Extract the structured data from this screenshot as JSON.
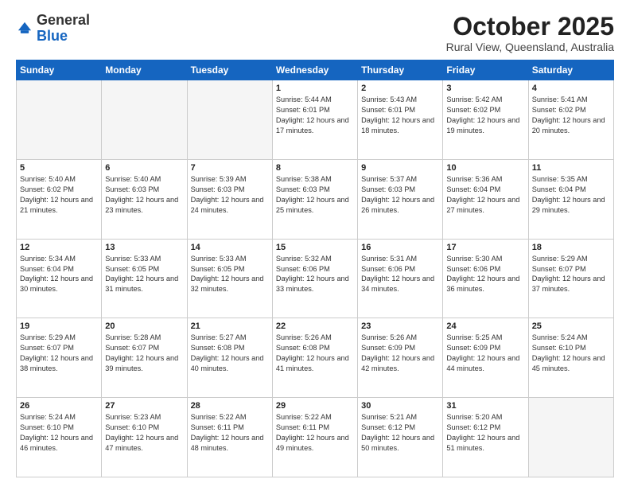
{
  "header": {
    "logo_general": "General",
    "logo_blue": "Blue",
    "month_title": "October 2025",
    "subtitle": "Rural View, Queensland, Australia"
  },
  "weekdays": [
    "Sunday",
    "Monday",
    "Tuesday",
    "Wednesday",
    "Thursday",
    "Friday",
    "Saturday"
  ],
  "weeks": [
    [
      {
        "day": "",
        "sunrise": "",
        "sunset": "",
        "daylight": "",
        "empty": true
      },
      {
        "day": "",
        "sunrise": "",
        "sunset": "",
        "daylight": "",
        "empty": true
      },
      {
        "day": "",
        "sunrise": "",
        "sunset": "",
        "daylight": "",
        "empty": true
      },
      {
        "day": "1",
        "sunrise": "Sunrise: 5:44 AM",
        "sunset": "Sunset: 6:01 PM",
        "daylight": "Daylight: 12 hours and 17 minutes.",
        "empty": false
      },
      {
        "day": "2",
        "sunrise": "Sunrise: 5:43 AM",
        "sunset": "Sunset: 6:01 PM",
        "daylight": "Daylight: 12 hours and 18 minutes.",
        "empty": false
      },
      {
        "day": "3",
        "sunrise": "Sunrise: 5:42 AM",
        "sunset": "Sunset: 6:02 PM",
        "daylight": "Daylight: 12 hours and 19 minutes.",
        "empty": false
      },
      {
        "day": "4",
        "sunrise": "Sunrise: 5:41 AM",
        "sunset": "Sunset: 6:02 PM",
        "daylight": "Daylight: 12 hours and 20 minutes.",
        "empty": false
      }
    ],
    [
      {
        "day": "5",
        "sunrise": "Sunrise: 5:40 AM",
        "sunset": "Sunset: 6:02 PM",
        "daylight": "Daylight: 12 hours and 21 minutes.",
        "empty": false
      },
      {
        "day": "6",
        "sunrise": "Sunrise: 5:40 AM",
        "sunset": "Sunset: 6:03 PM",
        "daylight": "Daylight: 12 hours and 23 minutes.",
        "empty": false
      },
      {
        "day": "7",
        "sunrise": "Sunrise: 5:39 AM",
        "sunset": "Sunset: 6:03 PM",
        "daylight": "Daylight: 12 hours and 24 minutes.",
        "empty": false
      },
      {
        "day": "8",
        "sunrise": "Sunrise: 5:38 AM",
        "sunset": "Sunset: 6:03 PM",
        "daylight": "Daylight: 12 hours and 25 minutes.",
        "empty": false
      },
      {
        "day": "9",
        "sunrise": "Sunrise: 5:37 AM",
        "sunset": "Sunset: 6:03 PM",
        "daylight": "Daylight: 12 hours and 26 minutes.",
        "empty": false
      },
      {
        "day": "10",
        "sunrise": "Sunrise: 5:36 AM",
        "sunset": "Sunset: 6:04 PM",
        "daylight": "Daylight: 12 hours and 27 minutes.",
        "empty": false
      },
      {
        "day": "11",
        "sunrise": "Sunrise: 5:35 AM",
        "sunset": "Sunset: 6:04 PM",
        "daylight": "Daylight: 12 hours and 29 minutes.",
        "empty": false
      }
    ],
    [
      {
        "day": "12",
        "sunrise": "Sunrise: 5:34 AM",
        "sunset": "Sunset: 6:04 PM",
        "daylight": "Daylight: 12 hours and 30 minutes.",
        "empty": false
      },
      {
        "day": "13",
        "sunrise": "Sunrise: 5:33 AM",
        "sunset": "Sunset: 6:05 PM",
        "daylight": "Daylight: 12 hours and 31 minutes.",
        "empty": false
      },
      {
        "day": "14",
        "sunrise": "Sunrise: 5:33 AM",
        "sunset": "Sunset: 6:05 PM",
        "daylight": "Daylight: 12 hours and 32 minutes.",
        "empty": false
      },
      {
        "day": "15",
        "sunrise": "Sunrise: 5:32 AM",
        "sunset": "Sunset: 6:06 PM",
        "daylight": "Daylight: 12 hours and 33 minutes.",
        "empty": false
      },
      {
        "day": "16",
        "sunrise": "Sunrise: 5:31 AM",
        "sunset": "Sunset: 6:06 PM",
        "daylight": "Daylight: 12 hours and 34 minutes.",
        "empty": false
      },
      {
        "day": "17",
        "sunrise": "Sunrise: 5:30 AM",
        "sunset": "Sunset: 6:06 PM",
        "daylight": "Daylight: 12 hours and 36 minutes.",
        "empty": false
      },
      {
        "day": "18",
        "sunrise": "Sunrise: 5:29 AM",
        "sunset": "Sunset: 6:07 PM",
        "daylight": "Daylight: 12 hours and 37 minutes.",
        "empty": false
      }
    ],
    [
      {
        "day": "19",
        "sunrise": "Sunrise: 5:29 AM",
        "sunset": "Sunset: 6:07 PM",
        "daylight": "Daylight: 12 hours and 38 minutes.",
        "empty": false
      },
      {
        "day": "20",
        "sunrise": "Sunrise: 5:28 AM",
        "sunset": "Sunset: 6:07 PM",
        "daylight": "Daylight: 12 hours and 39 minutes.",
        "empty": false
      },
      {
        "day": "21",
        "sunrise": "Sunrise: 5:27 AM",
        "sunset": "Sunset: 6:08 PM",
        "daylight": "Daylight: 12 hours and 40 minutes.",
        "empty": false
      },
      {
        "day": "22",
        "sunrise": "Sunrise: 5:26 AM",
        "sunset": "Sunset: 6:08 PM",
        "daylight": "Daylight: 12 hours and 41 minutes.",
        "empty": false
      },
      {
        "day": "23",
        "sunrise": "Sunrise: 5:26 AM",
        "sunset": "Sunset: 6:09 PM",
        "daylight": "Daylight: 12 hours and 42 minutes.",
        "empty": false
      },
      {
        "day": "24",
        "sunrise": "Sunrise: 5:25 AM",
        "sunset": "Sunset: 6:09 PM",
        "daylight": "Daylight: 12 hours and 44 minutes.",
        "empty": false
      },
      {
        "day": "25",
        "sunrise": "Sunrise: 5:24 AM",
        "sunset": "Sunset: 6:10 PM",
        "daylight": "Daylight: 12 hours and 45 minutes.",
        "empty": false
      }
    ],
    [
      {
        "day": "26",
        "sunrise": "Sunrise: 5:24 AM",
        "sunset": "Sunset: 6:10 PM",
        "daylight": "Daylight: 12 hours and 46 minutes.",
        "empty": false
      },
      {
        "day": "27",
        "sunrise": "Sunrise: 5:23 AM",
        "sunset": "Sunset: 6:10 PM",
        "daylight": "Daylight: 12 hours and 47 minutes.",
        "empty": false
      },
      {
        "day": "28",
        "sunrise": "Sunrise: 5:22 AM",
        "sunset": "Sunset: 6:11 PM",
        "daylight": "Daylight: 12 hours and 48 minutes.",
        "empty": false
      },
      {
        "day": "29",
        "sunrise": "Sunrise: 5:22 AM",
        "sunset": "Sunset: 6:11 PM",
        "daylight": "Daylight: 12 hours and 49 minutes.",
        "empty": false
      },
      {
        "day": "30",
        "sunrise": "Sunrise: 5:21 AM",
        "sunset": "Sunset: 6:12 PM",
        "daylight": "Daylight: 12 hours and 50 minutes.",
        "empty": false
      },
      {
        "day": "31",
        "sunrise": "Sunrise: 5:20 AM",
        "sunset": "Sunset: 6:12 PM",
        "daylight": "Daylight: 12 hours and 51 minutes.",
        "empty": false
      },
      {
        "day": "",
        "sunrise": "",
        "sunset": "",
        "daylight": "",
        "empty": true
      }
    ]
  ]
}
